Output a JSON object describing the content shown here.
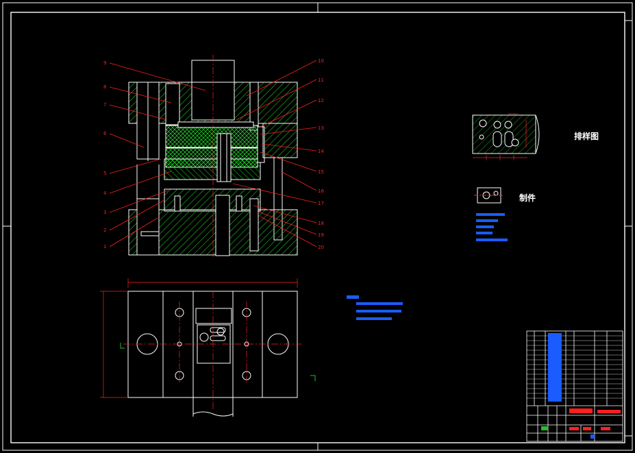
{
  "colors": {
    "background": "#000000",
    "outline": "#ffffff",
    "hatch": "#22c02a",
    "leader": "#ff2020",
    "dimension": "#ffffff",
    "note": "#1a5cff",
    "yellow": "#ffd21e"
  },
  "part_numbers_left": [
    "9",
    "8",
    "7",
    "6",
    "5",
    "4",
    "3",
    "2",
    "1"
  ],
  "part_numbers_right": [
    "10",
    "11",
    "12",
    "13",
    "14",
    "15",
    "16",
    "17",
    "18",
    "19",
    "20"
  ],
  "labels": {
    "layout_diagram": "排样图",
    "workpiece": "制件"
  }
}
